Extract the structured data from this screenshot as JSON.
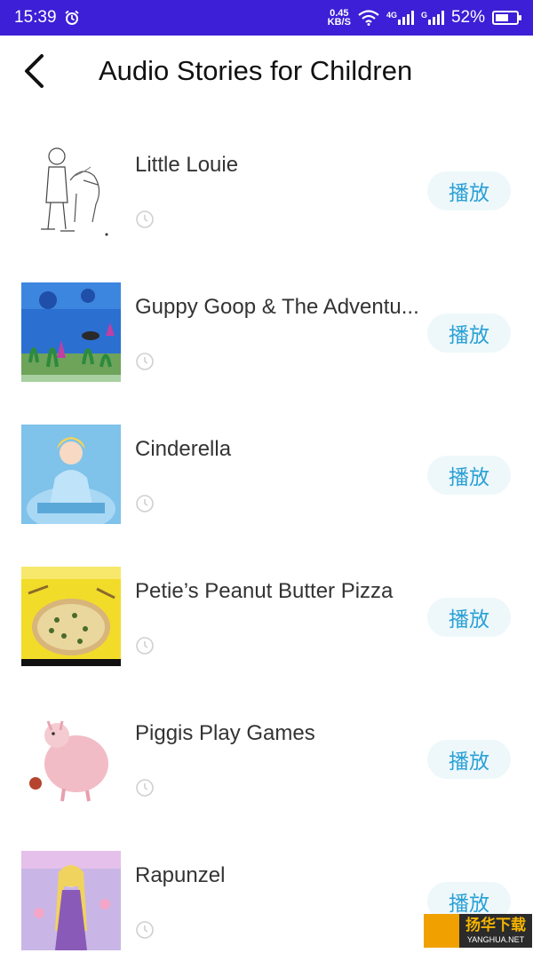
{
  "status_bar": {
    "time": "15:39",
    "net_speed_value": "0.45",
    "net_speed_unit": "KB/S",
    "network_1": "4G",
    "network_2": "G",
    "battery": "52%"
  },
  "header": {
    "title": "Audio Stories for Children"
  },
  "stories": [
    {
      "title": "Little Louie",
      "play_label": "播放",
      "thumb": "boy-with-dog-sketch"
    },
    {
      "title": "Guppy Goop & The Adventu...",
      "play_label": "播放",
      "thumb": "underwater-scene"
    },
    {
      "title": "Cinderella",
      "play_label": "播放",
      "thumb": "cinderella-cover"
    },
    {
      "title": "Petie’s Peanut Butter Pizza",
      "play_label": "播放",
      "thumb": "pizza-cover"
    },
    {
      "title": "Piggis Play Games",
      "play_label": "播放",
      "thumb": "pink-pig-drawing"
    },
    {
      "title": "Rapunzel",
      "play_label": "播放",
      "thumb": "rapunzel-cover"
    }
  ],
  "watermark": {
    "cn": "扬华下载",
    "en": "YANGHUA.NET"
  },
  "colors": {
    "status_bar": "#3c1fd6",
    "play_text": "#2aa0d6",
    "play_bg": "#eef8fb"
  }
}
